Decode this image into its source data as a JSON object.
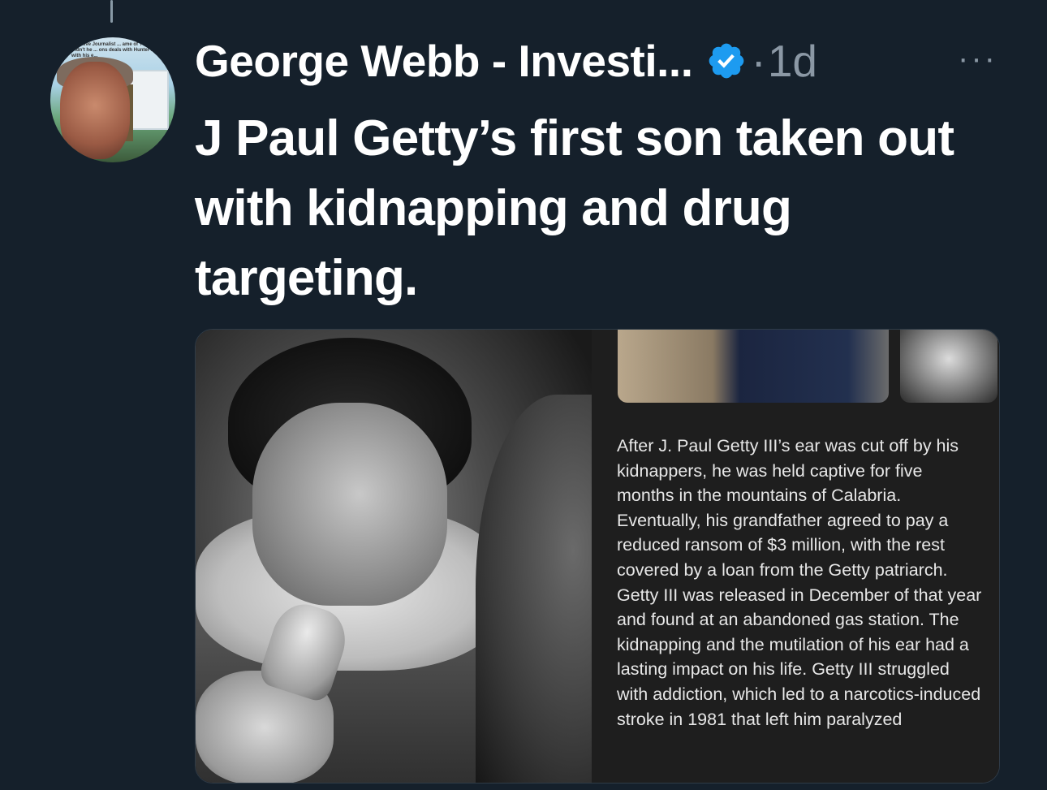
{
  "author": {
    "display_name": "George Webb - Investi...",
    "verified_icon": "verified-badge-icon",
    "separator": "·",
    "timestamp": "1d",
    "avatar_caption": "...igative Journalist ... ame of Yu to Trump? Didn't he ... ons deals with Hunter Biden with his e..."
  },
  "more_menu": {
    "label": "···",
    "icon": "more-options-icon"
  },
  "tweet": {
    "text": "J Paul Getty’s first son taken out with kidnapping and drug targeting."
  },
  "media": {
    "article_text": "After J. Paul Getty III’s ear was cut off by his kidnappers, he was held captive for five months in the mountains of Calabria. Eventually, his grandfather agreed to pay a reduced ransom of $3 million, with the rest covered by a loan from the Getty patriarch. Getty III was released in December of that year and found at an abandoned gas station. The kidnapping and the mutilation of his ear had a lasting impact on his life. Getty III struggled with addiction, which led to a narcotics-induced stroke in 1981 that left him paralyzed"
  },
  "colors": {
    "background": "#15202b",
    "text_primary": "#ffffff",
    "text_secondary": "#8b98a5",
    "verified_blue": "#1d9bf0"
  }
}
